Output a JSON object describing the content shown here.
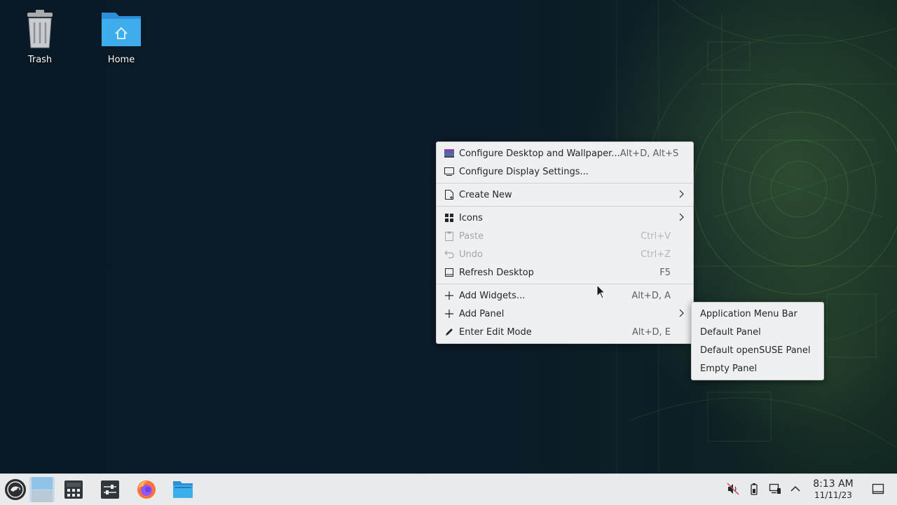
{
  "desktop": {
    "icons": [
      {
        "label": "Trash",
        "icon": "trash-icon"
      },
      {
        "label": "Home",
        "icon": "home-folder-icon"
      }
    ]
  },
  "context_menu": {
    "items": [
      {
        "label": "Configure Desktop and Wallpaper...",
        "shortcut": "Alt+D, Alt+S",
        "icon": "wallpaper-icon"
      },
      {
        "label": "Configure Display Settings...",
        "shortcut": "",
        "icon": "display-icon"
      },
      {
        "label": "Create New",
        "shortcut": "",
        "icon": "new-document-icon",
        "submenu": true
      },
      {
        "label": "Icons",
        "shortcut": "",
        "icon": "grid-icon",
        "submenu": true
      },
      {
        "label": "Paste",
        "shortcut": "Ctrl+V",
        "icon": "paste-icon",
        "disabled": true
      },
      {
        "label": "Undo",
        "shortcut": "Ctrl+Z",
        "icon": "undo-icon",
        "disabled": true
      },
      {
        "label": "Refresh Desktop",
        "shortcut": "F5",
        "icon": "refresh-icon"
      },
      {
        "label": "Add Widgets...",
        "shortcut": "Alt+D, A",
        "icon": "plus-icon"
      },
      {
        "label": "Add Panel",
        "shortcut": "",
        "icon": "plus-icon",
        "submenu": true
      },
      {
        "label": "Enter Edit Mode",
        "shortcut": "Alt+D, E",
        "icon": "pencil-icon"
      }
    ]
  },
  "add_panel_submenu": {
    "items": [
      {
        "label": "Application Menu Bar"
      },
      {
        "label": "Default Panel"
      },
      {
        "label": "Default openSUSE Panel"
      },
      {
        "label": "Empty Panel"
      }
    ]
  },
  "taskbar": {
    "launchers": [
      {
        "name": "application-launcher-icon"
      },
      {
        "name": "desktop-pager-icon"
      },
      {
        "name": "calculator-icon"
      },
      {
        "name": "system-settings-icon"
      },
      {
        "name": "firefox-icon"
      },
      {
        "name": "file-manager-icon"
      }
    ],
    "tray": [
      "volume-muted-icon",
      "battery-icon",
      "network-icon",
      "expand-tray-icon"
    ],
    "clock": {
      "time": "8:13 AM",
      "date": "11/11/23"
    },
    "show_desktop_icon": "show-desktop-icon"
  },
  "colors": {
    "desktop_bg": "#0b1a27",
    "menu_bg": "#eff0f1",
    "taskbar_bg": "#e9eaeb",
    "accent": "#3daee9"
  }
}
